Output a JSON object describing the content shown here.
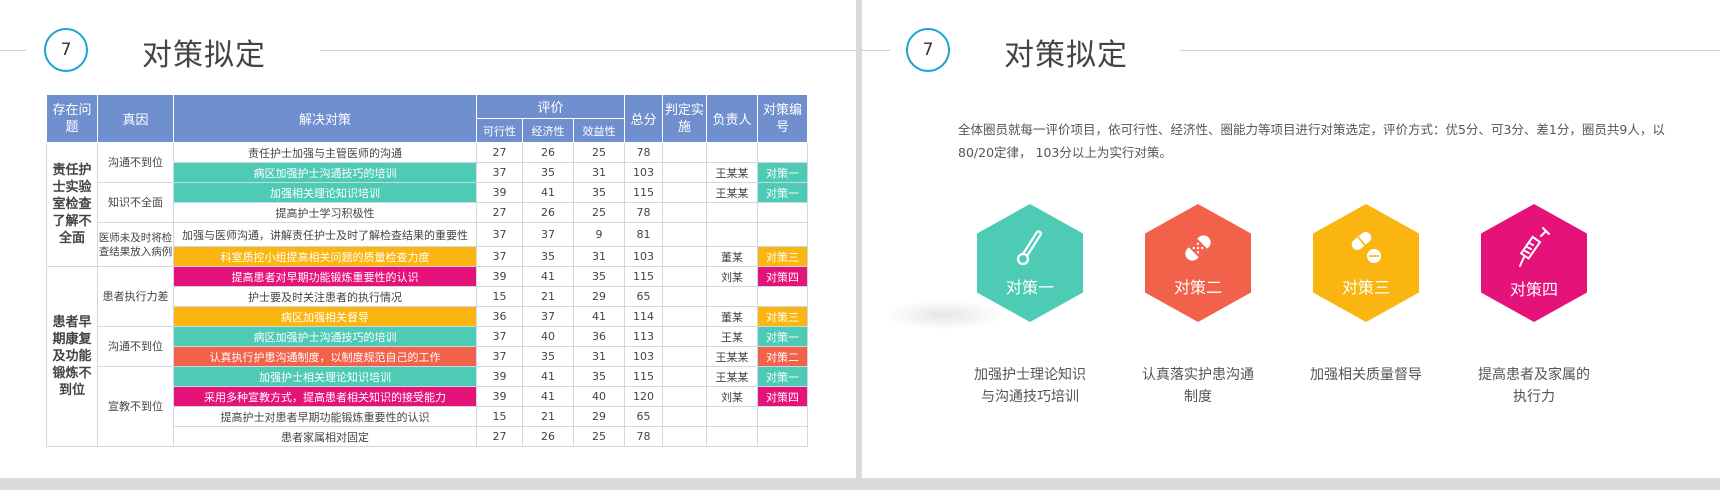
{
  "left": {
    "number": "7",
    "title": "对策拟定",
    "table": {
      "headers": {
        "problem": "存在问题",
        "cause": "真因",
        "solution": "解决对策",
        "evaluation": "评价",
        "feasibility": "可行性",
        "economy": "经济性",
        "benefit": "效益性",
        "total": "总分",
        "decision": "判定实施",
        "owner": "负责人",
        "code": "对策编号"
      },
      "problems": [
        "责任护士实验室检查了解不全面",
        "患者早期康复及功能锻炼不到位"
      ],
      "causes": [
        "沟通不到位",
        "知识不全面",
        "医师未及时将检查结果放入病例",
        "患者执行力差",
        "沟通不到位",
        "宣教不到位"
      ],
      "rows": [
        {
          "solution": "责任护士加强与主管医师的沟通",
          "a": "27",
          "b": "26",
          "c": "25",
          "total": "78",
          "owner": "",
          "code": ""
        },
        {
          "solution": "病区加强护士沟通技巧的培训",
          "a": "37",
          "b": "35",
          "c": "31",
          "total": "103",
          "owner": "王某某",
          "code": "对策一"
        },
        {
          "solution": "加强相关理论知识培训",
          "a": "39",
          "b": "41",
          "c": "35",
          "total": "115",
          "owner": "王某某",
          "code": "对策一"
        },
        {
          "solution": "提高护士学习积极性",
          "a": "27",
          "b": "26",
          "c": "25",
          "total": "78",
          "owner": "",
          "code": ""
        },
        {
          "solution": "加强与医师沟通，讲解责任护士及时了解检查结果的重要性",
          "a": "37",
          "b": "37",
          "c": "9",
          "total": "81",
          "owner": "",
          "code": ""
        },
        {
          "solution": "科室质控小组提高相关问题的质量检查力度",
          "a": "37",
          "b": "35",
          "c": "31",
          "total": "103",
          "owner": "董某",
          "code": "对策三"
        },
        {
          "solution": "提高患者对早期功能锻炼重要性的认识",
          "a": "39",
          "b": "41",
          "c": "35",
          "total": "115",
          "owner": "刘某",
          "code": "对策四"
        },
        {
          "solution": "护士要及时关注患者的执行情况",
          "a": "15",
          "b": "21",
          "c": "29",
          "total": "65",
          "owner": "",
          "code": ""
        },
        {
          "solution": "病区加强相关督导",
          "a": "36",
          "b": "37",
          "c": "41",
          "total": "114",
          "owner": "董某",
          "code": "对策三"
        },
        {
          "solution": "病区加强护士沟通技巧的培训",
          "a": "37",
          "b": "40",
          "c": "36",
          "total": "113",
          "owner": "王某",
          "code": "对策一"
        },
        {
          "solution": "认真执行护患沟通制度，以制度规范自己的工作",
          "a": "37",
          "b": "35",
          "c": "31",
          "total": "103",
          "owner": "王某某",
          "code": "对策二"
        },
        {
          "solution": "加强护士相关理论知识培训",
          "a": "39",
          "b": "41",
          "c": "35",
          "total": "115",
          "owner": "王某某",
          "code": "对策一"
        },
        {
          "solution": "采用多种宣教方式，提高患者相关知识的接受能力",
          "a": "39",
          "b": "41",
          "c": "40",
          "total": "120",
          "owner": "刘某",
          "code": "对策四"
        },
        {
          "solution": "提高护士对患者早期功能锻炼重要性的认识",
          "a": "15",
          "b": "21",
          "c": "29",
          "total": "65",
          "owner": "",
          "code": ""
        },
        {
          "solution": "患者家属相对固定",
          "a": "27",
          "b": "26",
          "c": "25",
          "total": "78",
          "owner": "",
          "code": ""
        }
      ]
    }
  },
  "right": {
    "number": "7",
    "title": "对策拟定",
    "description": "全体圈员就每一评价项目，依可行性、经济性、圈能力等项目进行对策选定，评价方式：优5分、可3分、差1分，圈员共9人，以80/20定律， 103分以上为实行对策。",
    "measures": [
      {
        "label": "对策一",
        "icon": "thermometer-icon",
        "color": "#4ecbb4",
        "caption_line1": "加强护士理论知识",
        "caption_line2": "与沟通技巧培训"
      },
      {
        "label": "对策二",
        "icon": "bandage-icon",
        "color": "#f26149",
        "caption_line1": "认真落实护患沟通",
        "caption_line2": "制度"
      },
      {
        "label": "对策三",
        "icon": "pills-icon",
        "color": "#fbb510",
        "caption_line1": "加强相关质量督导",
        "caption_line2": ""
      },
      {
        "label": "对策四",
        "icon": "syringe-icon",
        "color": "#e5127a",
        "caption_line1": "提高患者及家属的",
        "caption_line2": "执行力"
      }
    ]
  }
}
